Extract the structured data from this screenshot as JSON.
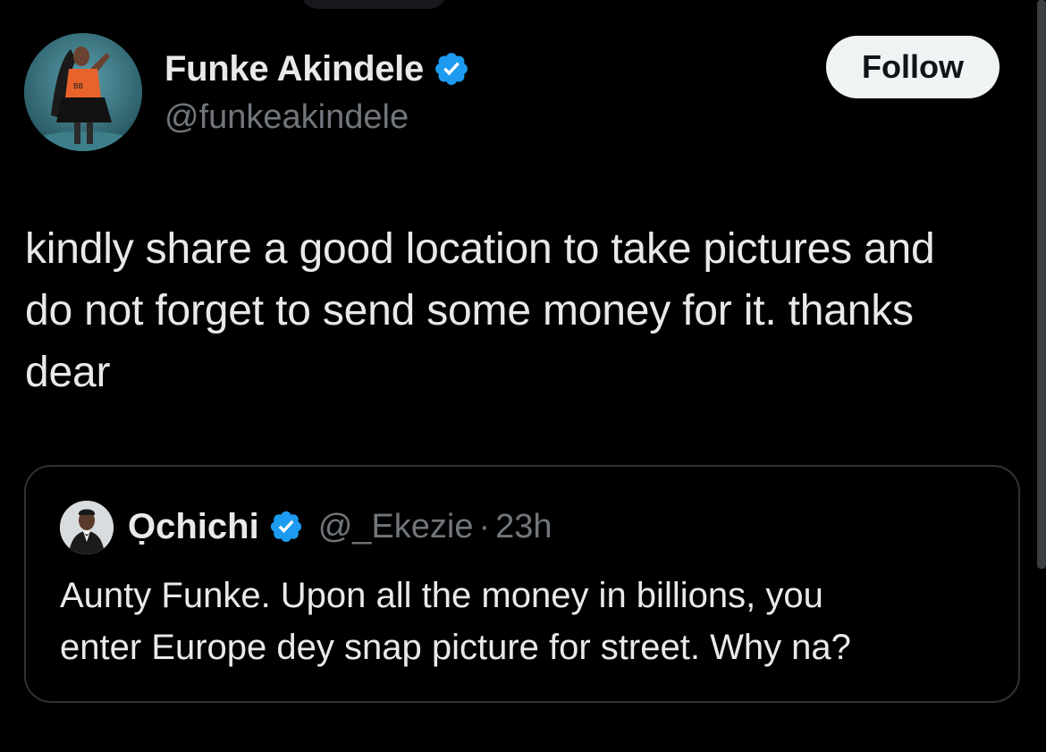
{
  "author": {
    "name": "Funke Akindele",
    "handle": "@funkeakindele",
    "verified": true,
    "avatar_icon": "profile-photo-woman-orange-top"
  },
  "follow_button": {
    "label": "Follow"
  },
  "tweet": {
    "text": "kindly share a good location to take pictures and\ndo not forget to send some money for it. thanks\ndear"
  },
  "quoted_tweet": {
    "name": "Ọchichi",
    "handle": "@_Ekezie",
    "separator": "·",
    "time": "23h",
    "verified": true,
    "text": "Aunty Funke. Upon all the money in billions, you\nenter Europe dey snap picture for street. Why na?",
    "avatar_icon": "profile-photo-man-suit"
  },
  "colors": {
    "background": "#000000",
    "primary_text": "#e7e9ea",
    "secondary_text": "#71767b",
    "verified_badge": "#1d9bf0",
    "border": "#2f3336",
    "follow_bg": "#eff3f4"
  }
}
